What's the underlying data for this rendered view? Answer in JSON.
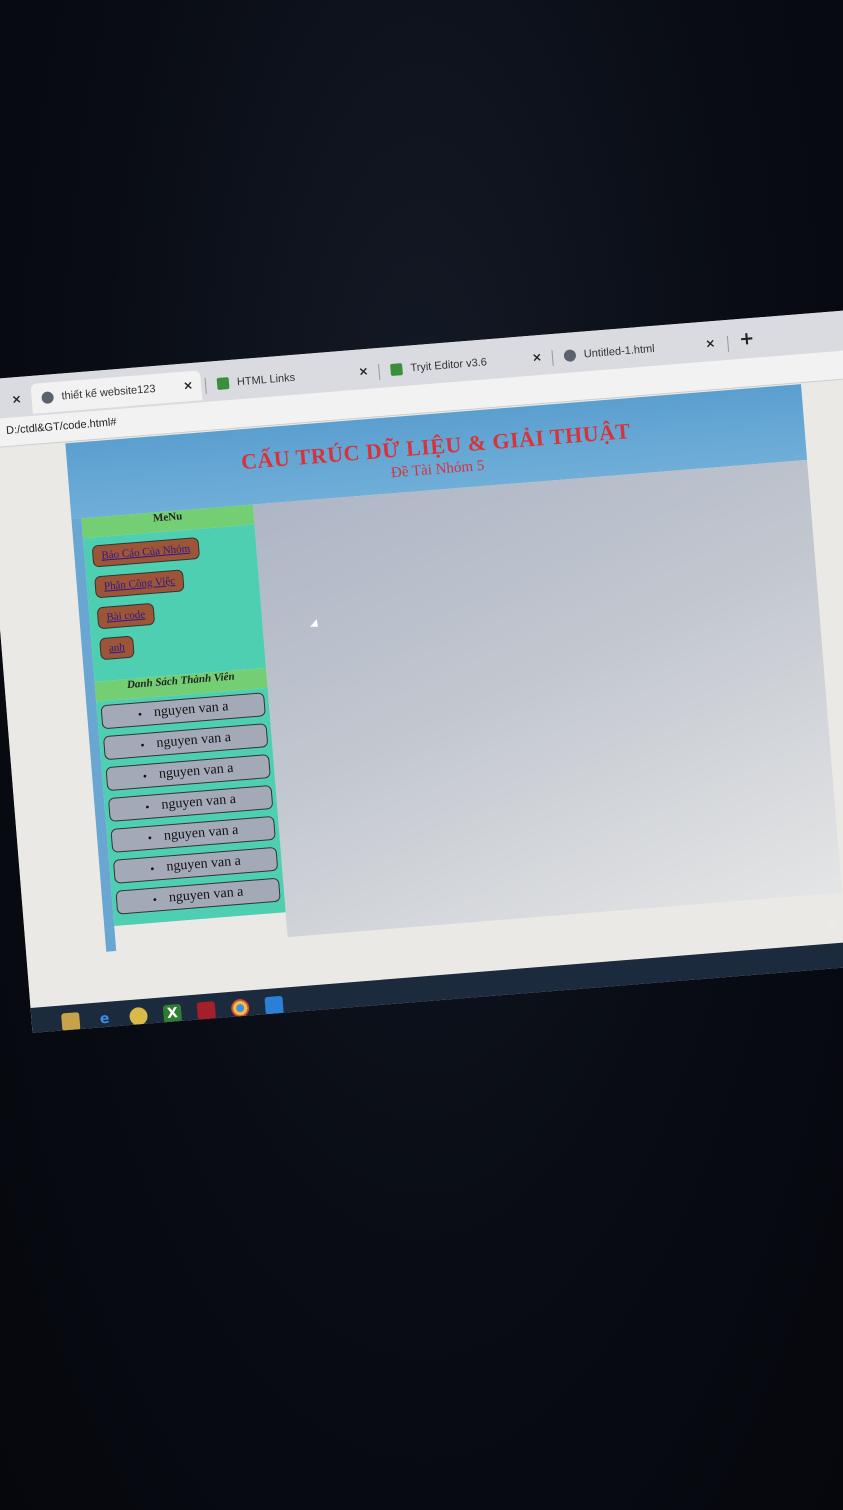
{
  "browser": {
    "tabs": [
      {
        "label": "thiết kế website123",
        "close": "×"
      },
      {
        "label": "HTML Links",
        "close": "×"
      },
      {
        "label": "Tryit Editor v3.6",
        "close": "×"
      },
      {
        "label": "Untitled-1.html",
        "close": "×"
      }
    ],
    "first_tab_close": "×",
    "new_tab": "+",
    "address": "D:/ctdl&GT/code.html#"
  },
  "page": {
    "title": "CẤU TRÚC DỮ LIỆU & GIẢI THUẬT",
    "subtitle": "Đề Tài Nhóm 5",
    "menu": {
      "header": "MeNu",
      "items": [
        "Báo Cáo Của Nhóm",
        "Phân Công Việc",
        "Bài code",
        "anh"
      ]
    },
    "members": {
      "header": "Danh Sách Thành Viên",
      "bullet": "•",
      "items": [
        "nguyen van a",
        "nguyen van a",
        "nguyen van a",
        "nguyen van a",
        "nguyen van a",
        "nguyen van a",
        "nguyen van a"
      ]
    }
  },
  "taskbar": {
    "icons": [
      "file-explorer-icon",
      "edge-icon",
      "chrome-canary-icon",
      "excel-icon",
      "app-icon",
      "chrome-icon",
      "vscode-icon"
    ],
    "tray_people": "ℛ",
    "tray_chevron": "^"
  },
  "colors": {
    "title_red": "#d8333a",
    "banner_blue": "#5b9fd0",
    "menu_green": "#74cf74",
    "panel_teal": "#4ecfb2",
    "menu_button": "#9d5538",
    "member_button": "#a3a9b7"
  }
}
